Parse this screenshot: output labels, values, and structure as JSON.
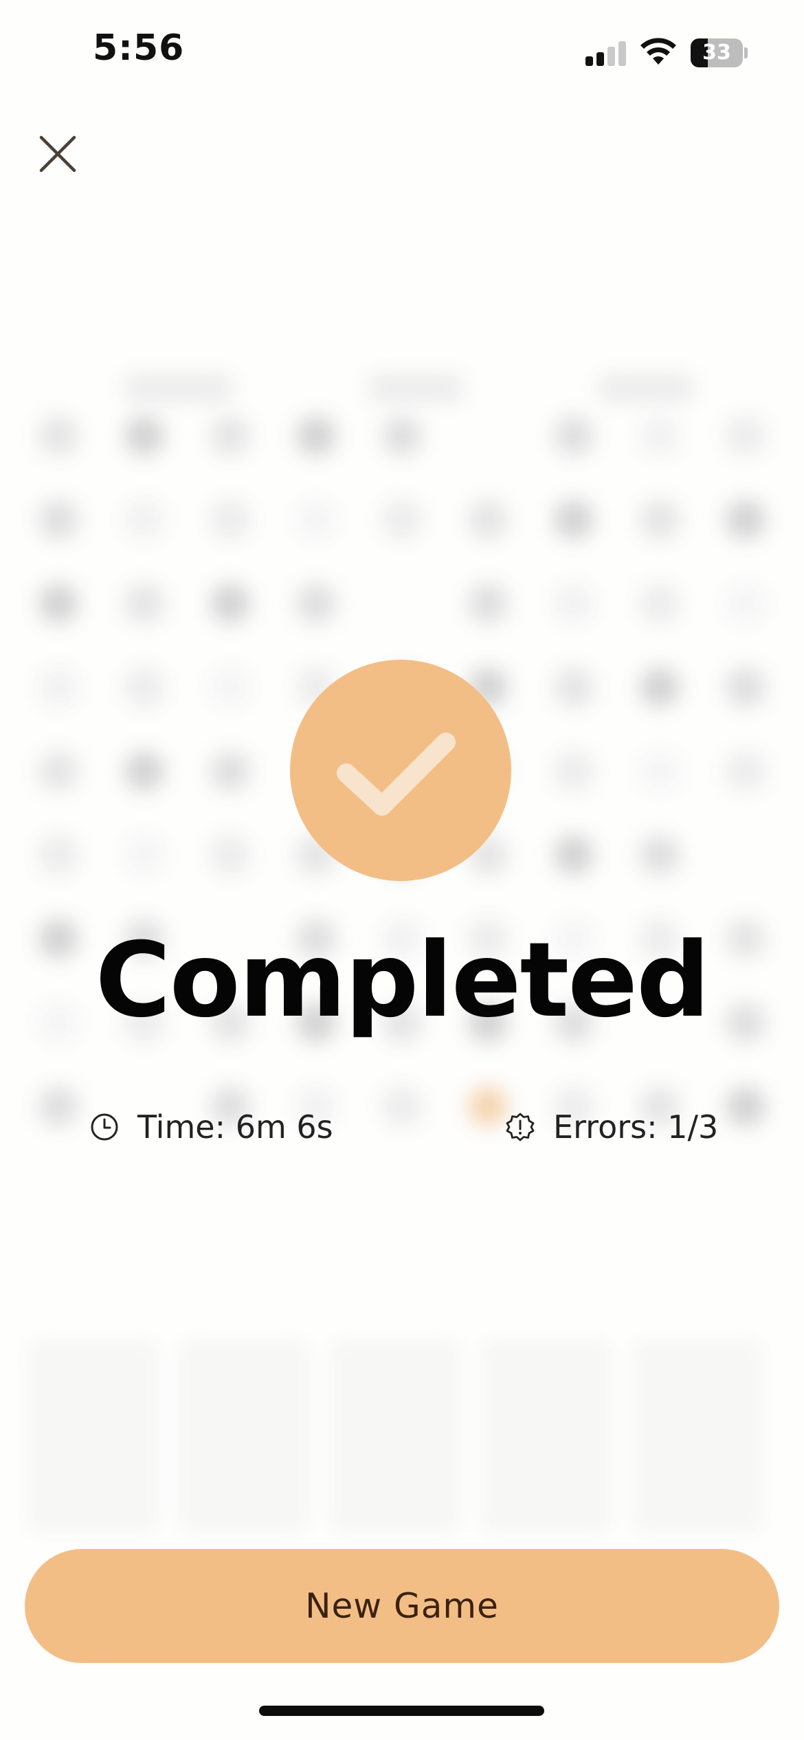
{
  "status_bar": {
    "time": "5:56",
    "battery_level": "33",
    "battery_percent": 33,
    "signal_bars_active": 2,
    "signal_bars_total": 4
  },
  "icons": {
    "close": "close-icon",
    "check": "checkmark-icon",
    "clock": "clock-icon",
    "error": "alert-badge-icon"
  },
  "result": {
    "title": "Completed",
    "time_text": "Time: 6m 6s",
    "errors_text": "Errors: 1/3"
  },
  "actions": {
    "new_game_label": "New Game"
  },
  "colors": {
    "accent": "#f3be86",
    "checkmark": "#f8e4cc",
    "title_text": "#050505",
    "button_text": "#3b2210"
  }
}
